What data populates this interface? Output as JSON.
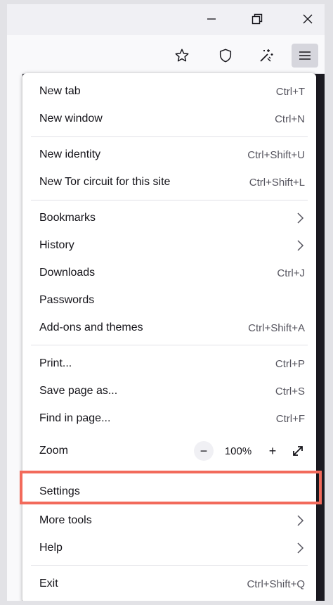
{
  "window": {
    "controls": [
      {
        "name": "minimize",
        "icon": "minimize-icon"
      },
      {
        "name": "restore",
        "icon": "restore-icon"
      },
      {
        "name": "close",
        "icon": "close-icon"
      }
    ]
  },
  "toolbar": {
    "buttons": [
      {
        "icon": "star-icon"
      },
      {
        "icon": "shield-icon"
      },
      {
        "icon": "magic-wand-icon"
      },
      {
        "icon": "hamburger-menu-icon",
        "active": true
      }
    ]
  },
  "menu": {
    "items": [
      {
        "label": "New tab",
        "shortcut": "Ctrl+T"
      },
      {
        "label": "New window",
        "shortcut": "Ctrl+N"
      },
      {
        "label": "New identity",
        "shortcut": "Ctrl+Shift+U"
      },
      {
        "label": "New Tor circuit for this site",
        "shortcut": "Ctrl+Shift+L"
      },
      {
        "label": "Bookmarks",
        "submenu": true
      },
      {
        "label": "History",
        "submenu": true
      },
      {
        "label": "Downloads",
        "shortcut": "Ctrl+J"
      },
      {
        "label": "Passwords",
        "shortcut": ""
      },
      {
        "label": "Add-ons and themes",
        "shortcut": "Ctrl+Shift+A"
      },
      {
        "label": "Print...",
        "shortcut": "Ctrl+P"
      },
      {
        "label": "Save page as...",
        "shortcut": "Ctrl+S"
      },
      {
        "label": "Find in page...",
        "shortcut": "Ctrl+F"
      },
      {
        "label": "Settings",
        "shortcut": ""
      },
      {
        "label": "More tools",
        "submenu": true
      },
      {
        "label": "Help",
        "submenu": true
      },
      {
        "label": "Exit",
        "shortcut": "Ctrl+Shift+Q"
      }
    ],
    "zoom": {
      "label": "Zoom",
      "minus": "−",
      "value": "100%",
      "plus": "+"
    }
  },
  "highlight": {
    "target": "Settings",
    "color": "#f26a5b"
  }
}
